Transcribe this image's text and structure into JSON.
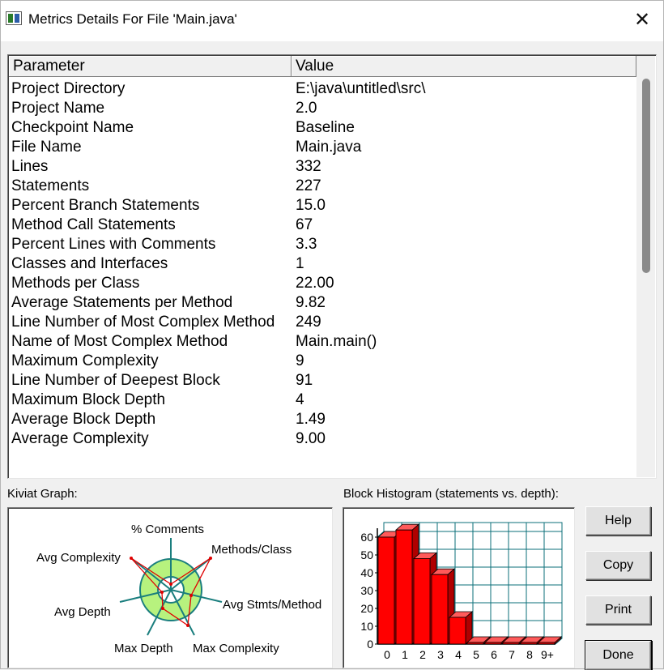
{
  "window": {
    "title": "Metrics Details For File 'Main.java'",
    "close_label": "✕"
  },
  "table": {
    "columns": [
      "Parameter",
      "Value"
    ],
    "rows": [
      [
        "Project Directory",
        "E:\\java\\untitled\\src\\"
      ],
      [
        "Project Name",
        "2.0"
      ],
      [
        "Checkpoint Name",
        "Baseline"
      ],
      [
        "File Name",
        "Main.java"
      ],
      [
        "Lines",
        "332"
      ],
      [
        "Statements",
        "227"
      ],
      [
        "Percent Branch Statements",
        "15.0"
      ],
      [
        "Method Call Statements",
        "67"
      ],
      [
        "Percent Lines with Comments",
        "3.3"
      ],
      [
        "Classes and Interfaces",
        "1"
      ],
      [
        "Methods per Class",
        "22.00"
      ],
      [
        "Average Statements per Method",
        "9.82"
      ],
      [
        "Line Number of Most Complex Method",
        "249"
      ],
      [
        "Name of Most Complex Method",
        "Main.main()"
      ],
      [
        "Maximum Complexity",
        "9"
      ],
      [
        "Line Number of Deepest Block",
        "91"
      ],
      [
        "Maximum Block Depth",
        "4"
      ],
      [
        "Average Block Depth",
        "1.49"
      ],
      [
        "Average Complexity",
        "9.00"
      ]
    ]
  },
  "kiviat": {
    "label": "Kiviat Graph:",
    "axes": {
      "comments": "% Comments",
      "methods_class": "Methods/Class",
      "avg_stmts": "Avg Stmts/Method",
      "max_complexity": "Max Complexity",
      "max_depth": "Max Depth",
      "avg_depth": "Avg Depth",
      "avg_complexity": "Avg Complexity"
    },
    "colors": {
      "ring": "#b7f27e",
      "axis": "#1a7e7e",
      "profile": "#e00000"
    }
  },
  "histogram": {
    "label": "Block Histogram (statements vs. depth):",
    "colors": {
      "bar": "#ff0000",
      "grid": "#0b6f78",
      "cell": "#ffffff"
    }
  },
  "chart_data": {
    "type": "bar",
    "title": "Block Histogram (statements vs. depth):",
    "categories": [
      "0",
      "1",
      "2",
      "3",
      "4",
      "5",
      "6",
      "7",
      "8",
      "9+"
    ],
    "values": [
      60,
      64,
      48,
      39,
      15,
      0,
      0,
      0,
      0,
      0
    ],
    "yticks": [
      0,
      10,
      20,
      30,
      40,
      50,
      60
    ],
    "ylim": [
      0,
      65
    ],
    "grid": true
  },
  "buttons": {
    "help": "Help",
    "copy": "Copy",
    "print": "Print",
    "done": "Done"
  }
}
